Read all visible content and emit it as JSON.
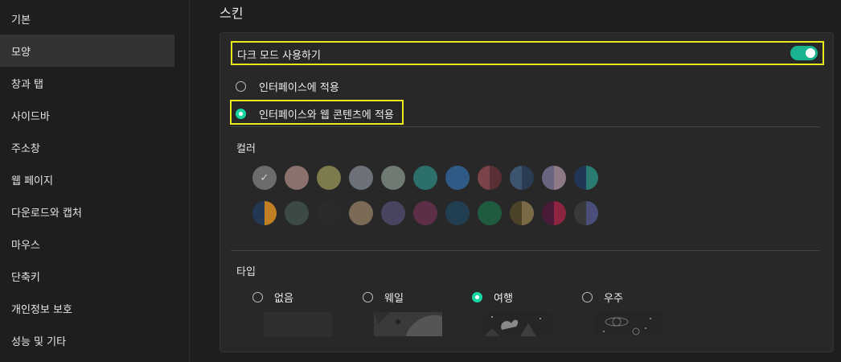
{
  "sidebar": {
    "items": [
      {
        "label": "기본",
        "active": false
      },
      {
        "label": "모양",
        "active": true
      },
      {
        "label": "창과 탭",
        "active": false
      },
      {
        "label": "사이드바",
        "active": false
      },
      {
        "label": "주소창",
        "active": false
      },
      {
        "label": "웹 페이지",
        "active": false
      },
      {
        "label": "다운로드와 캡처",
        "active": false
      },
      {
        "label": "마우스",
        "active": false
      },
      {
        "label": "단축키",
        "active": false
      },
      {
        "label": "개인정보 보호",
        "active": false
      },
      {
        "label": "성능 및 기타",
        "active": false
      }
    ]
  },
  "main": {
    "title": "스킨",
    "dark_mode": {
      "label": "다크 모드 사용하기",
      "enabled": true
    },
    "apply_options": [
      {
        "label": "인터페이스에 적용",
        "checked": false
      },
      {
        "label": "인터페이스와 웹 콘텐츠에 적용",
        "checked": true
      }
    ],
    "color_label": "컬러",
    "colors_row1": [
      {
        "name": "gray-selected",
        "left": "#6c6c6c",
        "right": "#6c6c6c",
        "selected": true
      },
      {
        "name": "mauve",
        "left": "#8a716c",
        "right": "#8a716c"
      },
      {
        "name": "olive",
        "left": "#7d7a4c",
        "right": "#7d7a4c"
      },
      {
        "name": "slate-gray",
        "left": "#6d7179",
        "right": "#6d7179"
      },
      {
        "name": "sage-gray",
        "left": "#6e7a72",
        "right": "#6e7a72"
      },
      {
        "name": "teal",
        "left": "#2c6f6b",
        "right": "#2c6f6b"
      },
      {
        "name": "steel-blue",
        "left": "#2e5a85",
        "right": "#2e5a85"
      },
      {
        "name": "maroon-split",
        "left": "#7a4448",
        "right": "#5a2f33"
      },
      {
        "name": "navy-split",
        "left": "#3c5470",
        "right": "#2a3c52"
      },
      {
        "name": "lavender-split",
        "left": "#6a6480",
        "right": "#8d7a86"
      },
      {
        "name": "navy-teal-split",
        "left": "#223556",
        "right": "#2a7a72"
      }
    ],
    "colors_row2": [
      {
        "name": "navy-orange-split",
        "left": "#233855",
        "right": "#c07f22"
      },
      {
        "name": "dark-green",
        "left": "#3b4b43",
        "right": "#3b4b43"
      },
      {
        "name": "charcoal",
        "left": "#2a2a2a",
        "right": "#2a2a2a"
      },
      {
        "name": "taupe",
        "left": "#7a6a56",
        "right": "#7a6a56"
      },
      {
        "name": "indigo-gray",
        "left": "#474560",
        "right": "#474560"
      },
      {
        "name": "plum",
        "left": "#5c2e48",
        "right": "#5c2e48"
      },
      {
        "name": "dark-teal-blue",
        "left": "#223f52",
        "right": "#223f52"
      },
      {
        "name": "forest",
        "left": "#1f5c3f",
        "right": "#1f5c3f"
      },
      {
        "name": "brown-split",
        "left": "#4b4228",
        "right": "#7a6a46"
      },
      {
        "name": "crimson-split",
        "left": "#4a1b38",
        "right": "#8d2540"
      },
      {
        "name": "gray-blue-split",
        "left": "#393939",
        "right": "#4a4f7a"
      }
    ],
    "type_label": "타입",
    "type_options": [
      {
        "label": "없음",
        "checked": false
      },
      {
        "label": "웨일",
        "checked": false
      },
      {
        "label": "여행",
        "checked": true
      },
      {
        "label": "우주",
        "checked": false
      }
    ]
  }
}
